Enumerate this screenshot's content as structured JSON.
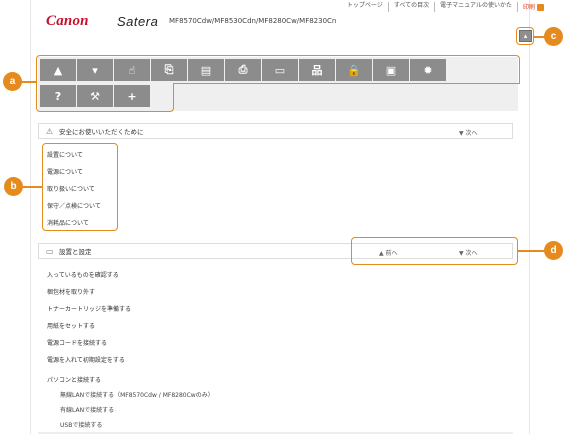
{
  "top_links": [
    "トップページ",
    "すべての目次",
    "電子マニュアルの使いかた"
  ],
  "print_label": "印刷",
  "brand": "Canon",
  "series": "Satera",
  "models": "MF8570Cdw/MF8530Cdn/MF8280Cw/MF8230Cn",
  "callouts": {
    "a": "a",
    "b": "b",
    "c": "c",
    "d": "d"
  },
  "nav_icons_row1": [
    "warning-icon",
    "printer-setup-icon",
    "hand-icon",
    "copy-icon",
    "fax-icon",
    "print-icon",
    "scan-icon",
    "network-icon",
    "security-icon",
    "remote-ui-icon",
    "settings-icon"
  ],
  "nav_icons_row2": [
    "help-icon",
    "wrench-icon",
    "plus-icon"
  ],
  "nav_glyphs_row1": [
    "▲",
    "▾",
    "☝",
    "⎘",
    "▤",
    "⎙",
    "▭",
    "品",
    "🔒",
    "▣",
    "✹"
  ],
  "nav_glyphs_row2": [
    "?",
    "⚒",
    "+"
  ],
  "safety": {
    "title": "安全にお使いいただくために",
    "next": "次へ",
    "items": [
      "設置について",
      "電源について",
      "取り扱いについて",
      "保守／点検について",
      "消耗品について"
    ]
  },
  "setup": {
    "title": "設置と設定",
    "prev": "前へ",
    "next": "次へ",
    "items": [
      "入っているものを確認する",
      "梱包材を取り外す",
      "トナーカートリッジを準備する",
      "用紙をセットする",
      "電源コードを接続する",
      "電源を入れて初期設定をする",
      "パソコンと接続する"
    ],
    "subitems": [
      "無線LANで接続する（MF8570Cdw / MF8280Cwのみ）",
      "有線LANで接続する",
      "USBで接続する"
    ]
  }
}
